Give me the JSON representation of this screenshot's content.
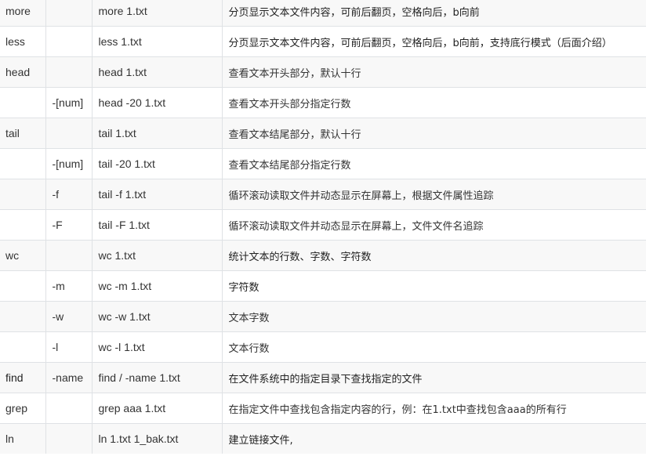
{
  "rows": [
    {
      "command": "more",
      "option": "",
      "example": "more 1.txt",
      "description": "分页显示文本文件内容，可前后翻页，空格向后，b向前"
    },
    {
      "command": "less",
      "option": "",
      "example": "less 1.txt",
      "description": "分页显示文本文件内容，可前后翻页，空格向后，b向前，支持底行模式（后面介绍）"
    },
    {
      "command": "head",
      "option": "",
      "example": "head 1.txt",
      "description": "查看文本开头部分，默认十行"
    },
    {
      "command": "",
      "option": "-[num]",
      "example": "head -20 1.txt",
      "description": "查看文本开头部分指定行数"
    },
    {
      "command": "tail",
      "option": "",
      "example": "tail 1.txt",
      "description": "查看文本结尾部分，默认十行"
    },
    {
      "command": "",
      "option": "-[num]",
      "example": "tail -20 1.txt",
      "description": "查看文本结尾部分指定行数"
    },
    {
      "command": "",
      "option": "-f",
      "example": "tail -f 1.txt",
      "description": "循环滚动读取文件并动态显示在屏幕上，根据文件属性追踪"
    },
    {
      "command": "",
      "option": "-F",
      "example": "tail -F 1.txt",
      "description": "循环滚动读取文件并动态显示在屏幕上，文件文件名追踪"
    },
    {
      "command": "wc",
      "option": "",
      "example": "wc 1.txt",
      "description": "统计文本的行数、字数、字符数"
    },
    {
      "command": "",
      "option": "-m",
      "example": "wc -m 1.txt",
      "description": "字符数"
    },
    {
      "command": "",
      "option": "-w",
      "example": "wc -w 1.txt",
      "description": "文本字数"
    },
    {
      "command": "",
      "option": "-l",
      "example": "wc -l 1.txt",
      "description": "文本行数"
    },
    {
      "command": "find",
      "option": "-name",
      "example": "find / -name 1.txt",
      "description": "在文件系统中的指定目录下查找指定的文件"
    },
    {
      "command": "grep",
      "option": "",
      "example": "grep aaa 1.txt",
      "description": "在指定文件中查找包含指定内容的行，例：在1.txt中查找包含aaa的所有行"
    },
    {
      "command": "ln",
      "option": "",
      "example": "ln 1.txt 1_bak.txt",
      "description": "建立链接文件,"
    }
  ]
}
